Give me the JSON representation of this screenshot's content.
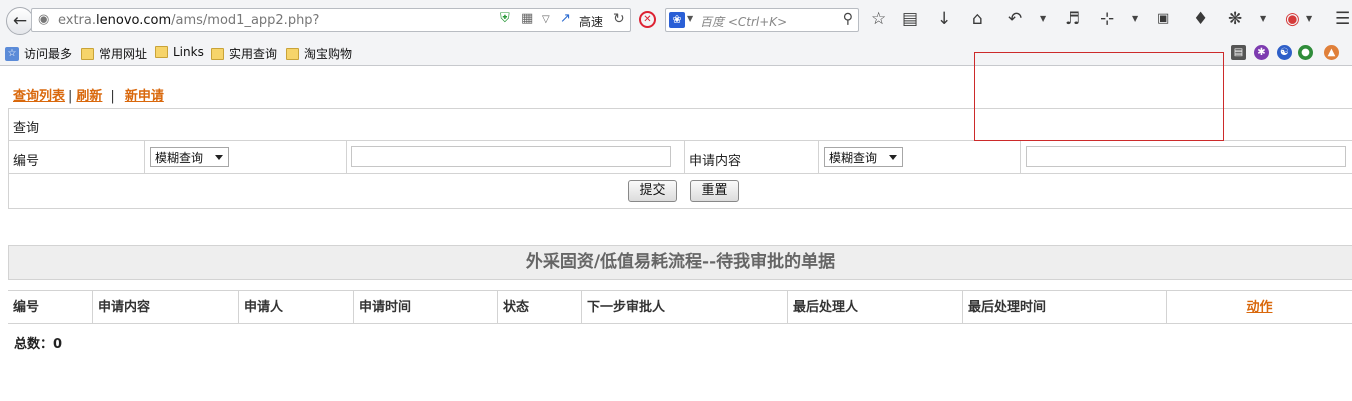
{
  "browser": {
    "url_host_prefix": "extra.",
    "url_host_main": "lenovo.com",
    "url_path": "/ams/mod1_app2.php?",
    "speed_label": "高速",
    "search_placeholder": "百度 <Ctrl+K>"
  },
  "bookmarks": [
    {
      "label": "访问最多",
      "icon": "most-visited-icon"
    },
    {
      "label": "常用网址",
      "icon": "folder-icon"
    },
    {
      "label": "Links",
      "icon": "folder-icon"
    },
    {
      "label": "实用查询",
      "icon": "folder-icon"
    },
    {
      "label": "淘宝购物",
      "icon": "folder-icon"
    }
  ],
  "links": {
    "query_list": "查询列表",
    "refresh": "刷新",
    "separator": "|",
    "new_request": "新申请"
  },
  "query": {
    "title": "查询",
    "number_label": "编号",
    "content_label": "申请内容",
    "mode_option": "模糊查询",
    "number_value": "",
    "content_value": "",
    "submit": "提交",
    "reset": "重置"
  },
  "section_title": "外采固资/低值易耗流程--待我审批的单据",
  "table": {
    "headers": [
      "编号",
      "申请内容",
      "申请人",
      "申请时间",
      "状态",
      "下一步审批人",
      "最后处理人",
      "最后处理时间"
    ],
    "action_header": "动作",
    "rows": []
  },
  "total_label": "总数：0",
  "colors": {
    "link": "#d9680c",
    "highlight_border": "#cc2a2a",
    "title_bg": "#eeeeee"
  }
}
